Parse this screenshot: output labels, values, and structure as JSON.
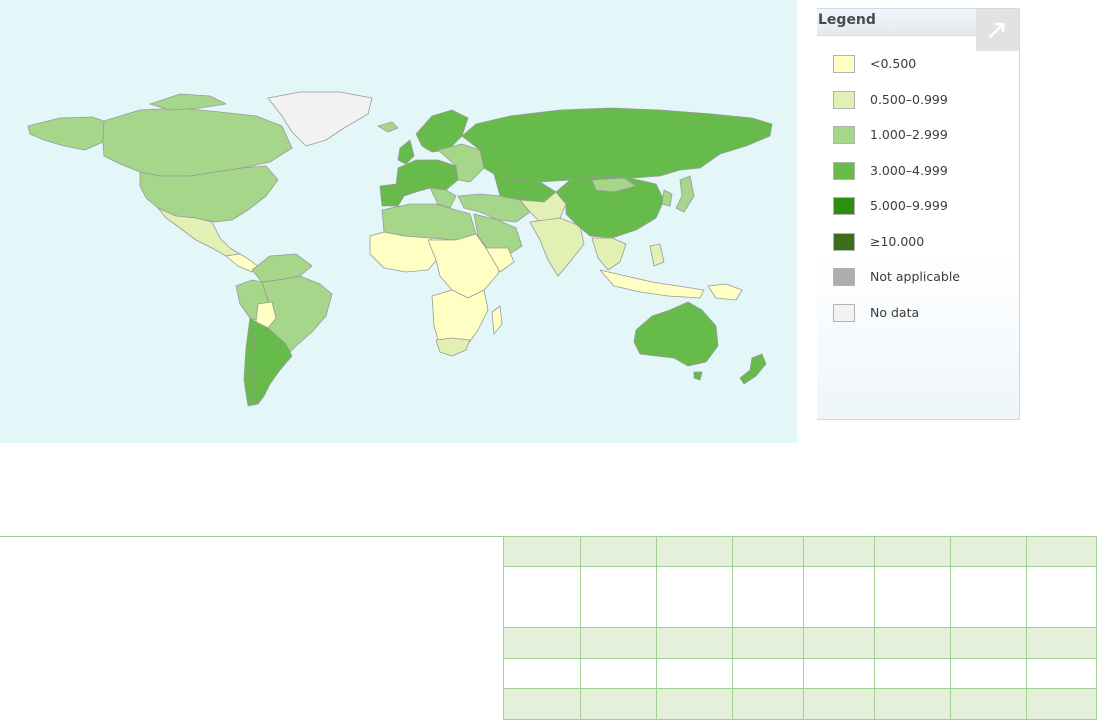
{
  "legend": {
    "title": "Legend",
    "items": [
      {
        "label": "<0.500",
        "color": "#ffffc4"
      },
      {
        "label": "0.500–0.999",
        "color": "#e2f0b3"
      },
      {
        "label": "1.000–2.999",
        "color": "#a6d689"
      },
      {
        "label": "3.000–4.999",
        "color": "#66bb4a"
      },
      {
        "label": "5.000–9.999",
        "color": "#2e8e12"
      },
      {
        "label": "≥10.000",
        "color": "#3d6e1c"
      },
      {
        "label": "Not applicable",
        "color": "#adadad"
      },
      {
        "label": "No data",
        "color": "#f2f2f2"
      }
    ]
  },
  "map": {
    "ocean_color": "#e3f7f8",
    "border_color": "#9a9a9a"
  },
  "table": {
    "rows": 5,
    "columns": 8,
    "row_styles": [
      "shaded",
      "plain",
      "shaded",
      "plain",
      "shaded"
    ]
  }
}
